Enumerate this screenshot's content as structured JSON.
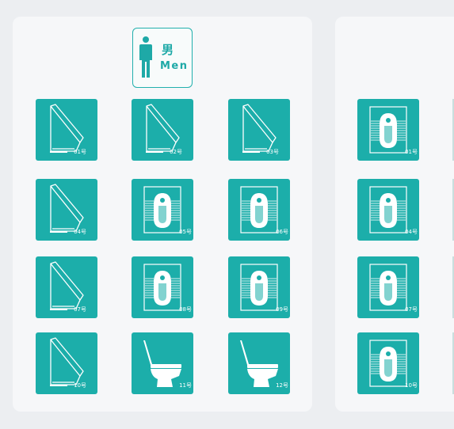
{
  "men_section": {
    "sign": {
      "chinese": "男",
      "english": "Men",
      "icon": "man-icon"
    },
    "stalls": [
      {
        "label": "01号",
        "type": "urinal"
      },
      {
        "label": "02号",
        "type": "urinal"
      },
      {
        "label": "03号",
        "type": "urinal"
      },
      {
        "label": "04号",
        "type": "urinal"
      },
      {
        "label": "05号",
        "type": "squat-toilet"
      },
      {
        "label": "06号",
        "type": "squat-toilet"
      },
      {
        "label": "07号",
        "type": "urinal"
      },
      {
        "label": "08号",
        "type": "squat-toilet"
      },
      {
        "label": "09号",
        "type": "squat-toilet"
      },
      {
        "label": "10号",
        "type": "urinal"
      },
      {
        "label": "11号",
        "type": "sitting-toilet"
      },
      {
        "label": "12号",
        "type": "sitting-toilet"
      }
    ]
  },
  "women_section": {
    "stalls": [
      {
        "label": "01号",
        "type": "squat-toilet"
      },
      {
        "label": "04号",
        "type": "squat-toilet"
      },
      {
        "label": "07号",
        "type": "squat-toilet"
      },
      {
        "label": "10号",
        "type": "squat-toilet"
      }
    ]
  },
  "colors": {
    "accent": "#1caeaa",
    "panel": "#f6f7f9",
    "background": "#eceef1"
  }
}
